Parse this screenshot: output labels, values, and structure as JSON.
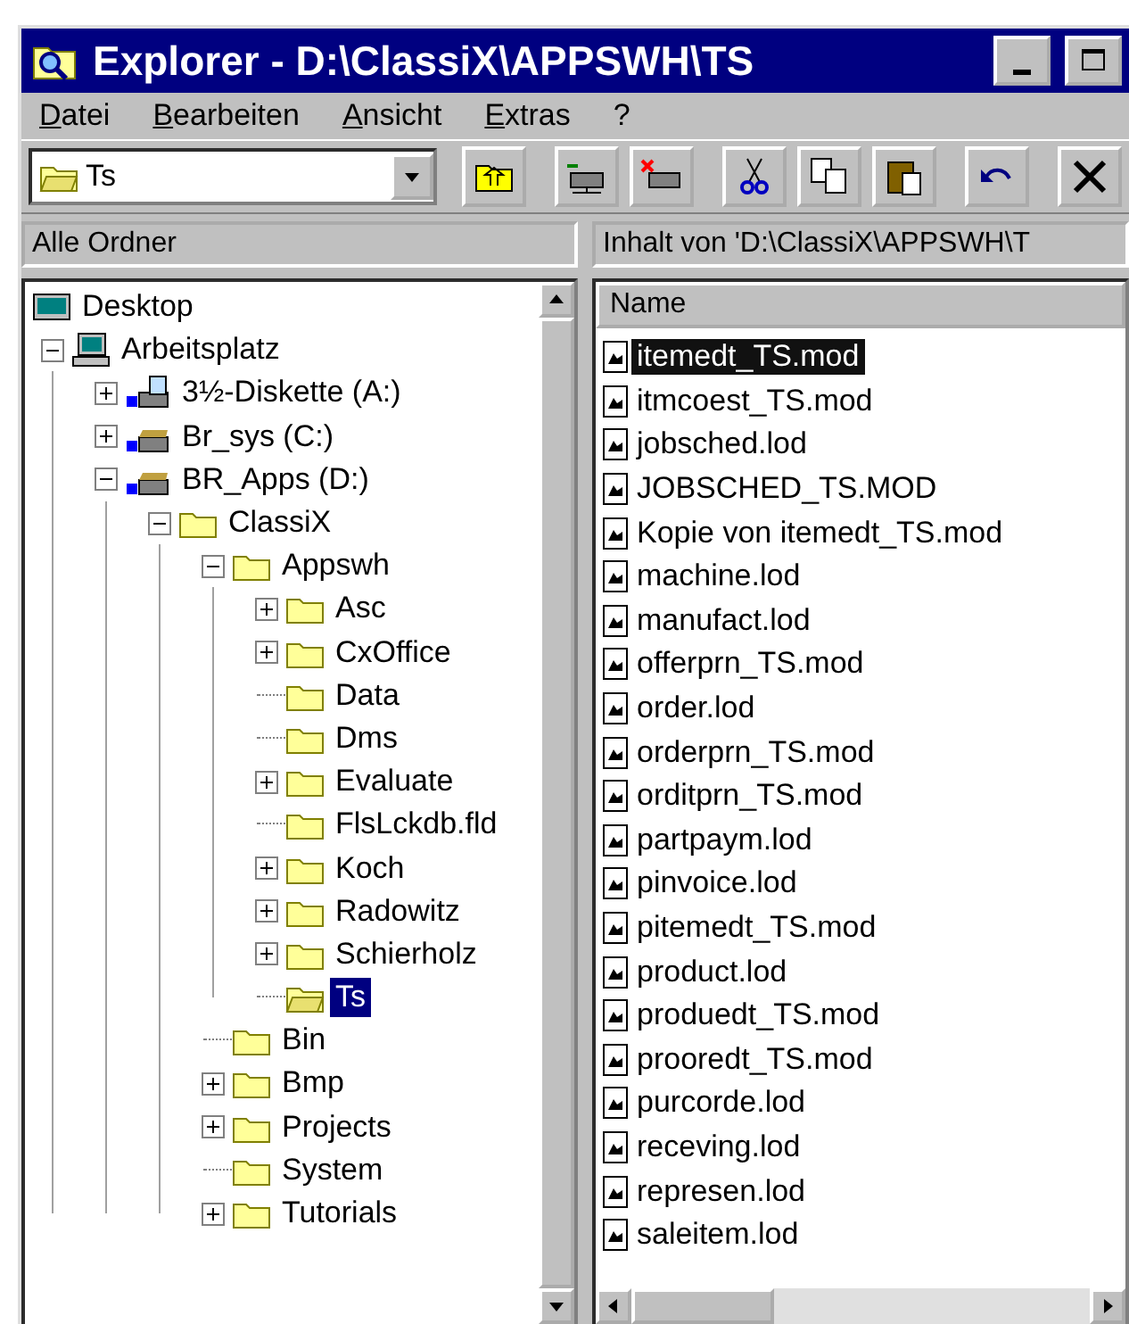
{
  "window": {
    "title": "Explorer - D:\\ClassiX\\APPSWH\\TS"
  },
  "menu": [
    "Datei",
    "Bearbeiten",
    "Ansicht",
    "Extras",
    "?"
  ],
  "address": {
    "value": "Ts"
  },
  "panes": {
    "left_header": "Alle Ordner",
    "right_header": "Inhalt von 'D:\\ClassiX\\APPSWH\\T"
  },
  "tree": {
    "label": "Desktop",
    "kind": "desktop",
    "selected": false,
    "children": [
      {
        "label": "Arbeitsplatz",
        "kind": "computer",
        "selected": false,
        "expanded": true,
        "children": [
          {
            "label": "3½-Diskette (A:)",
            "kind": "floppy",
            "selected": false,
            "expanded": false
          },
          {
            "label": "Br_sys (C:)",
            "kind": "drive",
            "selected": false,
            "expanded": false
          },
          {
            "label": "BR_Apps (D:)",
            "kind": "drive",
            "selected": false,
            "expanded": true,
            "children": [
              {
                "label": "ClassiX",
                "kind": "folder",
                "selected": false,
                "expanded": true,
                "children": [
                  {
                    "label": "Appswh",
                    "kind": "folder",
                    "selected": false,
                    "expanded": true,
                    "children": [
                      {
                        "label": "Asc",
                        "kind": "folder",
                        "selected": false,
                        "expanded": false
                      },
                      {
                        "label": "CxOffice",
                        "kind": "folder",
                        "selected": false,
                        "expanded": false
                      },
                      {
                        "label": "Data",
                        "kind": "folder",
                        "selected": false
                      },
                      {
                        "label": "Dms",
                        "kind": "folder",
                        "selected": false
                      },
                      {
                        "label": "Evaluate",
                        "kind": "folder",
                        "selected": false,
                        "expanded": false
                      },
                      {
                        "label": "FlsLckdb.fld",
                        "kind": "folder",
                        "selected": false
                      },
                      {
                        "label": "Koch",
                        "kind": "folder",
                        "selected": false,
                        "expanded": false
                      },
                      {
                        "label": "Radowitz",
                        "kind": "folder",
                        "selected": false,
                        "expanded": false
                      },
                      {
                        "label": "Schierholz",
                        "kind": "folder",
                        "selected": false,
                        "expanded": false
                      },
                      {
                        "label": "Ts",
                        "kind": "folder",
                        "selected": true
                      }
                    ]
                  },
                  {
                    "label": "Bin",
                    "kind": "folder",
                    "selected": false
                  },
                  {
                    "label": "Bmp",
                    "kind": "folder",
                    "selected": false,
                    "expanded": false
                  },
                  {
                    "label": "Projects",
                    "kind": "folder",
                    "selected": false,
                    "expanded": false
                  },
                  {
                    "label": "System",
                    "kind": "folder",
                    "selected": false
                  },
                  {
                    "label": "Tutorials",
                    "kind": "folder",
                    "selected": false,
                    "expanded": false
                  }
                ]
              }
            ]
          }
        ]
      }
    ]
  },
  "list": {
    "column": "Name",
    "files": [
      {
        "name": "itemedt_TS.mod",
        "selected": true
      },
      {
        "name": "itmcoest_TS.mod",
        "selected": false
      },
      {
        "name": "jobsched.lod",
        "selected": false
      },
      {
        "name": "JOBSCHED_TS.MOD",
        "selected": false
      },
      {
        "name": "Kopie von itemedt_TS.mod",
        "selected": false
      },
      {
        "name": "machine.lod",
        "selected": false
      },
      {
        "name": "manufact.lod",
        "selected": false
      },
      {
        "name": "offerprn_TS.mod",
        "selected": false
      },
      {
        "name": "order.lod",
        "selected": false
      },
      {
        "name": "orderprn_TS.mod",
        "selected": false
      },
      {
        "name": "orditprn_TS.mod",
        "selected": false
      },
      {
        "name": "partpaym.lod",
        "selected": false
      },
      {
        "name": "pinvoice.lod",
        "selected": false
      },
      {
        "name": "pitemedt_TS.mod",
        "selected": false
      },
      {
        "name": "product.lod",
        "selected": false
      },
      {
        "name": "produedt_TS.mod",
        "selected": false
      },
      {
        "name": "prooredt_TS.mod",
        "selected": false
      },
      {
        "name": "purcorde.lod",
        "selected": false
      },
      {
        "name": "receving.lod",
        "selected": false
      },
      {
        "name": "represen.lod",
        "selected": false
      },
      {
        "name": "saleitem.lod",
        "selected": false
      }
    ]
  }
}
